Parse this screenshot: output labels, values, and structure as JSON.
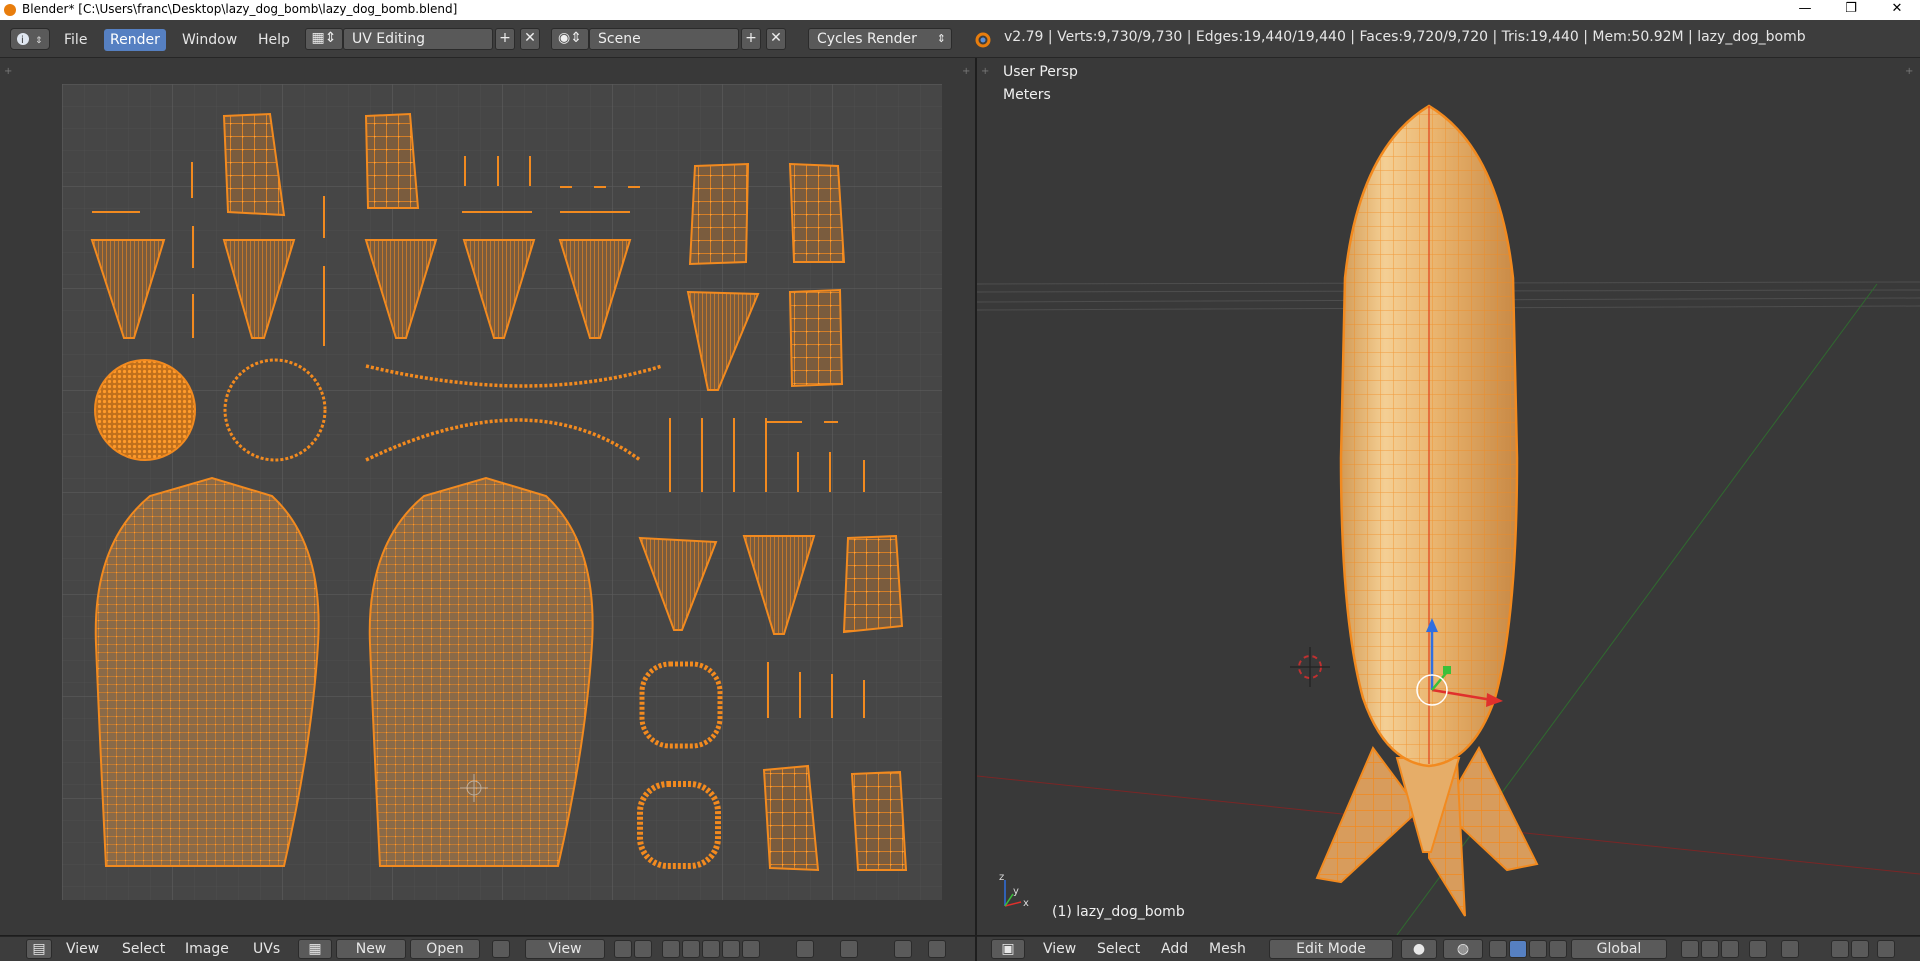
{
  "window": {
    "title": "Blender* [C:\\Users\\franc\\Desktop\\lazy_dog_bomb\\lazy_dog_bomb.blend]",
    "minimize": "—",
    "restore": "❐",
    "close": "✕"
  },
  "menubar": {
    "info_icon": "info-icon",
    "menus": [
      "File",
      "Render",
      "Window",
      "Help"
    ],
    "active_menu": "Render",
    "screen_layout": "UV Editing",
    "scene": "Scene",
    "render_engine": "Cycles Render",
    "stats": "v2.79 | Verts:9,730/9,730 | Edges:19,440/19,440 | Faces:9,720/9,720 | Tris:19,440 | Mem:50.92M | lazy_dog_bomb"
  },
  "viewport": {
    "view_name": "User Persp",
    "units": "Meters",
    "object_label": "(1) lazy_dog_bomb"
  },
  "uv_footer": {
    "menus": [
      "View",
      "Select",
      "Image",
      "UVs"
    ],
    "new_label": "New",
    "open_label": "Open",
    "view_label": "View"
  },
  "view3d_footer": {
    "menus": [
      "View",
      "Select",
      "Add",
      "Mesh"
    ],
    "mode": "Edit Mode",
    "orientation": "Global"
  },
  "colors": {
    "accent": "#f28a1f",
    "selected_fill": "#8a6a48",
    "mesh_fill": "#e9b36d",
    "active_menu": "#5680c2"
  }
}
